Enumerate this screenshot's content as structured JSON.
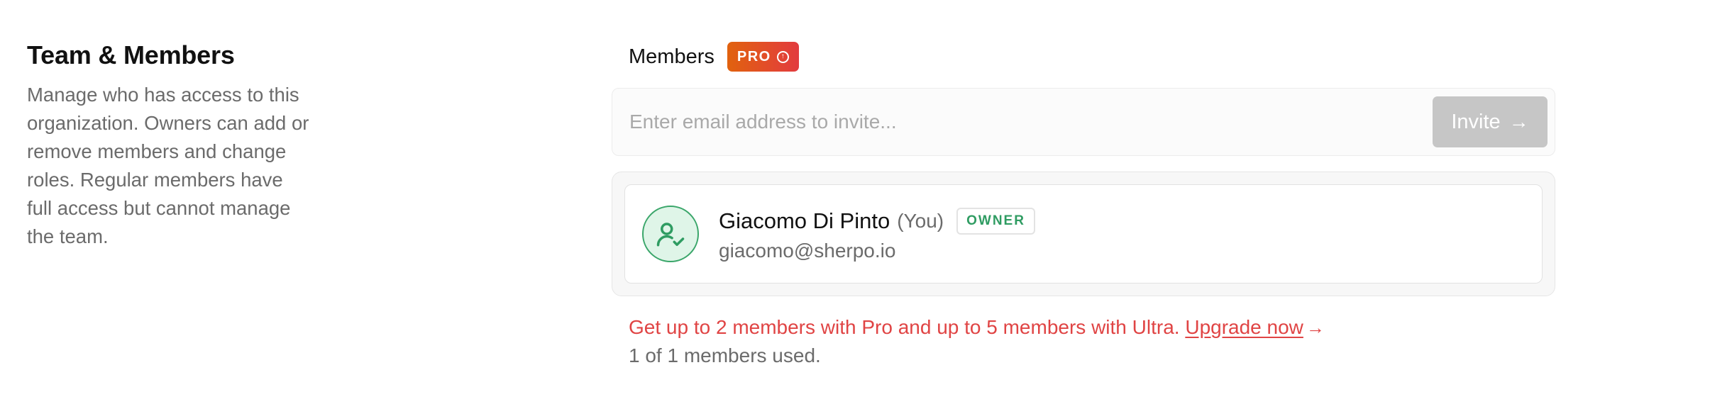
{
  "section": {
    "title": "Team & Members",
    "description": "Manage who has access to this organization. Owners can add or remove members and change roles. Regular members have full access but cannot manage the team."
  },
  "members": {
    "label": "Members",
    "badge": "PRO",
    "badge_icon": "upgrade-arrow-circle-icon",
    "invite": {
      "placeholder": "Enter email address to invite...",
      "value": "",
      "button_label": "Invite",
      "button_icon": "arrow-right-icon"
    },
    "list": [
      {
        "name": "Giacomo Di Pinto",
        "you_label": "(You)",
        "role": "OWNER",
        "email": "giacomo@sherpo.io",
        "avatar_icon": "user-check-icon"
      }
    ],
    "upgrade": {
      "text": "Get up to 2 members with Pro and up to 5 members with Ultra.",
      "link_label": "Upgrade now",
      "arrow": "→"
    },
    "usage": "1 of 1 members used."
  },
  "colors": {
    "pro_badge_from": "#e1620e",
    "pro_badge_to": "#e23b3f",
    "owner_green": "#2f9c62",
    "avatar_bg": "#dff5e8",
    "upgrade_red": "#e04444",
    "invite_button_disabled": "#c6c6c6"
  }
}
